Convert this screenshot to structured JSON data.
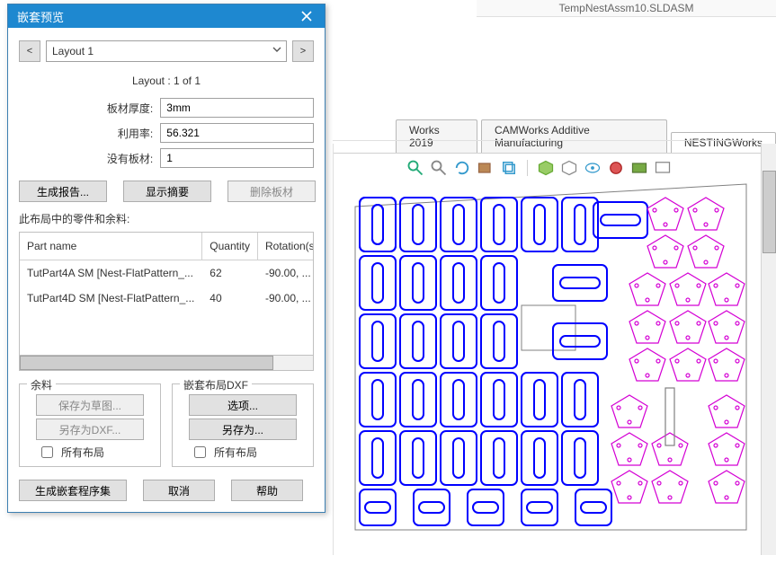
{
  "docTitle": "TempNestAssm10.SLDASM",
  "dialog": {
    "title": "嵌套预览",
    "prev": "<",
    "next": ">",
    "layoutName": "Layout 1",
    "layoutInfoLabel": "Layout :",
    "layoutInfoValue": "1 of 1",
    "sheetThicknessLabel": "板材厚度:",
    "sheetThicknessValue": "3mm",
    "utilizationLabel": "利用率:",
    "utilizationValue": "56.321",
    "noSheetLabel": "没有板材:",
    "noSheetValue": "1",
    "genReport": "生成报告...",
    "showSummary": "显示摘要",
    "deleteSheet": "删除板材",
    "partsHeader": "此布局中的零件和余料:",
    "cols": {
      "name": "Part name",
      "qty": "Quantity",
      "rot": "Rotation(s)"
    },
    "rows": [
      {
        "name": "TutPart4A SM [Nest-FlatPattern_...",
        "qty": "62",
        "rot": "-90.00, ..."
      },
      {
        "name": "TutPart4D SM [Nest-FlatPattern_...",
        "qty": "40",
        "rot": "-90.00, ..."
      }
    ],
    "remnant": {
      "legend": "余料",
      "saveSketch": "保存为草图...",
      "saveDxf": "另存为DXF...",
      "allLayouts": "所有布局"
    },
    "nestdxf": {
      "legend": "嵌套布局DXF",
      "options": "选项...",
      "saveAs": "另存为...",
      "allLayouts": "所有布局"
    },
    "bottom": {
      "gen": "生成嵌套程序集",
      "cancel": "取消",
      "help": "帮助"
    }
  },
  "tabs": {
    "t1": "Works 2019",
    "t2": "CAMWorks Additive Manufacturing",
    "t3": "NESTINGWorks"
  }
}
